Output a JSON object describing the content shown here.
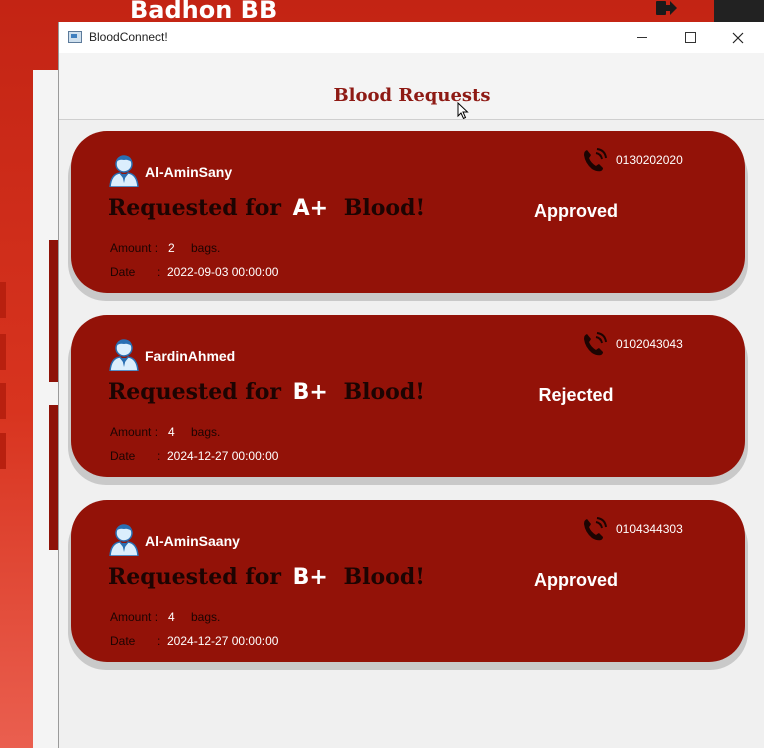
{
  "background": {
    "title": "Badhon BB"
  },
  "window": {
    "title": "BloodConnect!"
  },
  "page": {
    "title": "Blood Requests"
  },
  "labels": {
    "requested_prefix": "Requested for",
    "blood_suffix": "Blood!",
    "amount": "Amount :",
    "bags": "bags.",
    "date": "Date",
    "date_colon": ":"
  },
  "requests": [
    {
      "name": "Al-AminSany",
      "phone": "0130202020",
      "blood_type": "A+",
      "status": "Approved",
      "amount": "2",
      "date": "2022-09-03 00:00:00"
    },
    {
      "name": "FardinAhmed",
      "phone": "0102043043",
      "blood_type": "B+",
      "status": "Rejected",
      "amount": "4",
      "date": "2024-12-27 00:00:00"
    },
    {
      "name": "Al-AminSaany",
      "phone": "0104344303",
      "blood_type": "B+",
      "status": "Approved",
      "amount": "4",
      "date": "2024-12-27 00:00:00"
    }
  ],
  "colors": {
    "card": "#931208",
    "title": "#8e1a14",
    "background_app": "#c32414"
  },
  "icons": {
    "avatar": "user-avatar-icon",
    "phone": "phone-icon",
    "logout": "logout-icon"
  }
}
